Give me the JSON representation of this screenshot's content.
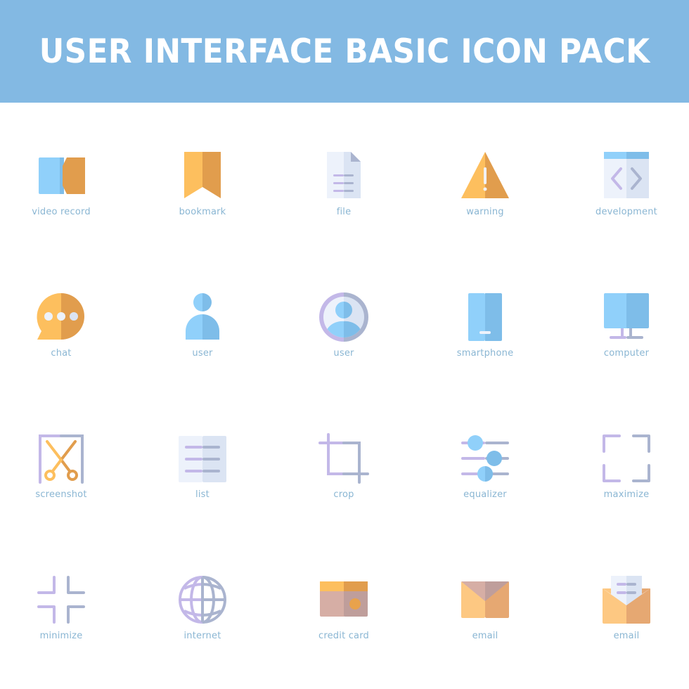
{
  "banner": {
    "title": "USER INTERFACE BASIC ICON PACK"
  },
  "colors": {
    "banner_bg": "#83b9e3",
    "label": "#8ab6d3",
    "blue_light": "#90d0fa",
    "blue_dark": "#7ebde9",
    "orange_light": "#fdbf5e",
    "orange_dark": "#e19d4d",
    "lavender": "#c3b8e8",
    "slate": "#aab4cf",
    "paper_light": "#edf2fb",
    "paper_dark": "#dbe4f3"
  },
  "icons": [
    {
      "name": "video-record-icon",
      "label": "video record"
    },
    {
      "name": "bookmark-icon",
      "label": "bookmark"
    },
    {
      "name": "file-icon",
      "label": "file"
    },
    {
      "name": "warning-icon",
      "label": "warning"
    },
    {
      "name": "development-icon",
      "label": "development"
    },
    {
      "name": "chat-icon",
      "label": "chat"
    },
    {
      "name": "user-icon",
      "label": "user"
    },
    {
      "name": "user-circle-icon",
      "label": "user"
    },
    {
      "name": "smartphone-icon",
      "label": "smartphone"
    },
    {
      "name": "computer-icon",
      "label": "computer"
    },
    {
      "name": "screenshot-icon",
      "label": "screenshot"
    },
    {
      "name": "list-icon",
      "label": "list"
    },
    {
      "name": "crop-icon",
      "label": "crop"
    },
    {
      "name": "equalizer-icon",
      "label": "equalizer"
    },
    {
      "name": "maximize-icon",
      "label": "maximize"
    },
    {
      "name": "minimize-icon",
      "label": "minimize"
    },
    {
      "name": "internet-icon",
      "label": "internet"
    },
    {
      "name": "credit-card-icon",
      "label": "credit card"
    },
    {
      "name": "email-icon",
      "label": "email"
    },
    {
      "name": "email-open-icon",
      "label": "email"
    }
  ]
}
